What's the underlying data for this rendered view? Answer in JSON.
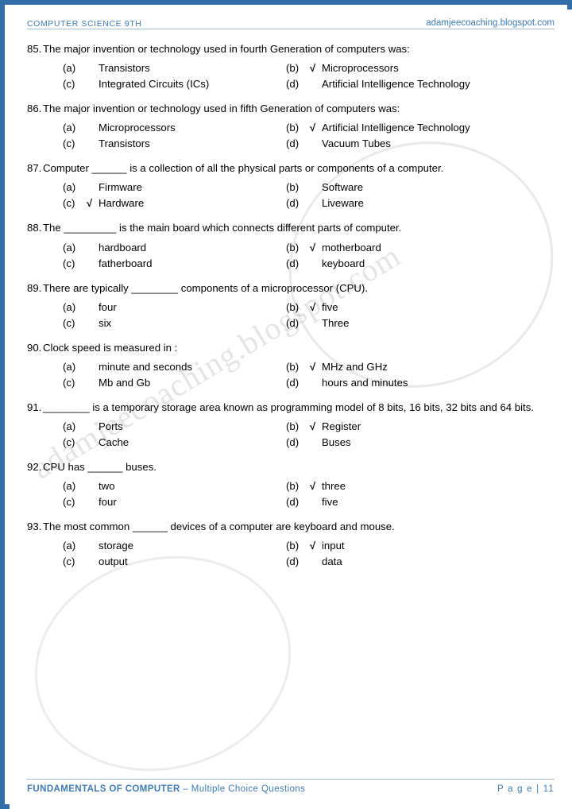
{
  "header": {
    "left": "COMPUTER SCIENCE 9TH",
    "right": "adamjeecoaching.blogspot.com"
  },
  "footer": {
    "left_bold": "FUNDAMENTALS OF COMPUTER",
    "left_rest": " – Multiple Choice Questions",
    "right": "P a g e  | 11"
  },
  "watermark": {
    "diagonal": "adamjeecoaching.blogspot.com"
  },
  "tick": "√",
  "questions": [
    {
      "num": "85.",
      "text": "The major invention or technology used in fourth Generation of computers was:",
      "options": [
        {
          "label": "(a)",
          "tick": "",
          "text": "Transistors"
        },
        {
          "label": "(b)",
          "tick": "√",
          "text": "Microprocessors"
        },
        {
          "label": "(c)",
          "tick": "",
          "text": "Integrated Circuits (ICs)"
        },
        {
          "label": "(d)",
          "tick": "",
          "text": "Artificial Intelligence Technology"
        }
      ]
    },
    {
      "num": "86.",
      "text": "The major invention or technology used in fifth Generation of computers was:",
      "options": [
        {
          "label": "(a)",
          "tick": "",
          "text": "Microprocessors"
        },
        {
          "label": "(b)",
          "tick": "√",
          "text": "Artificial Intelligence Technology"
        },
        {
          "label": "(c)",
          "tick": "",
          "text": "Transistors"
        },
        {
          "label": "(d)",
          "tick": "",
          "text": "Vacuum Tubes"
        }
      ]
    },
    {
      "num": "87.",
      "text": "Computer ______ is a collection of all the physical parts or components of a computer.",
      "options": [
        {
          "label": "(a)",
          "tick": "",
          "text": "Firmware"
        },
        {
          "label": "(b)",
          "tick": "",
          "text": "Software"
        },
        {
          "label": "(c)",
          "tick": "√",
          "text": "Hardware"
        },
        {
          "label": "(d)",
          "tick": "",
          "text": "Liveware"
        }
      ]
    },
    {
      "num": "88.",
      "text": "The _________ is the main board which connects different parts of computer.",
      "options": [
        {
          "label": "(a)",
          "tick": "",
          "text": "hardboard"
        },
        {
          "label": "(b)",
          "tick": "√",
          "text": "motherboard"
        },
        {
          "label": "(c)",
          "tick": "",
          "text": "fatherboard"
        },
        {
          "label": "(d)",
          "tick": "",
          "text": "keyboard"
        }
      ]
    },
    {
      "num": "89.",
      "text": "There are typically ________ components of a microprocessor (CPU).",
      "options": [
        {
          "label": "(a)",
          "tick": "",
          "text": "four"
        },
        {
          "label": "(b)",
          "tick": "√",
          "text": "five"
        },
        {
          "label": "(c)",
          "tick": "",
          "text": "six"
        },
        {
          "label": "(d)",
          "tick": "",
          "text": "Three"
        }
      ]
    },
    {
      "num": "90.",
      "text": "Clock speed is measured in :",
      "options": [
        {
          "label": "(a)",
          "tick": "",
          "text": "minute and seconds"
        },
        {
          "label": "(b)",
          "tick": "√",
          "text": "MHz and GHz"
        },
        {
          "label": "(c)",
          "tick": "",
          "text": "Mb and Gb"
        },
        {
          "label": "(d)",
          "tick": "",
          "text": "hours and minutes"
        }
      ]
    },
    {
      "num": "91.",
      "text": "________ is a temporary storage area known as programming model of 8 bits, 16 bits, 32 bits and 64 bits.",
      "options": [
        {
          "label": "(a)",
          "tick": "",
          "text": "Ports"
        },
        {
          "label": "(b)",
          "tick": "√",
          "text": "Register"
        },
        {
          "label": "(c)",
          "tick": "",
          "text": "Cache"
        },
        {
          "label": "(d)",
          "tick": "",
          "text": "Buses"
        }
      ]
    },
    {
      "num": "92.",
      "text": "CPU has ______ buses.",
      "options": [
        {
          "label": "(a)",
          "tick": "",
          "text": "two"
        },
        {
          "label": "(b)",
          "tick": "√",
          "text": "three"
        },
        {
          "label": "(c)",
          "tick": "",
          "text": "four"
        },
        {
          "label": "(d)",
          "tick": "",
          "text": "five"
        }
      ]
    },
    {
      "num": "93.",
      "text": "The most common ______ devices of a computer are keyboard and mouse.",
      "options": [
        {
          "label": "(a)",
          "tick": "",
          "text": "storage"
        },
        {
          "label": "(b)",
          "tick": "√",
          "text": "input"
        },
        {
          "label": "(c)",
          "tick": "",
          "text": "output"
        },
        {
          "label": "(d)",
          "tick": "",
          "text": "data"
        }
      ]
    }
  ]
}
